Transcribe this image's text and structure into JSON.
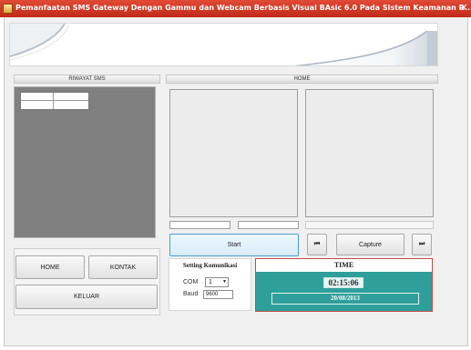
{
  "window": {
    "title": "Pemanfaatan SMS Gateway Dengan Gammu dan Webcam Berbasis Visual BAsic 6.0 Pada Sistem Keamanan R...",
    "close_glyph": "✕"
  },
  "riwayat": {
    "header": "RIWAYAT SMS"
  },
  "home_panel": {
    "header": "HOME",
    "start_label": "Start",
    "capture_label": "Capture",
    "prev_glyph": "⏮",
    "next_glyph": "⏭"
  },
  "nav": {
    "home_label": "HOME",
    "kontak_label": "KONTAK",
    "keluar_label": "KELUAR"
  },
  "setting": {
    "title": "Setting Komunikasi",
    "com_label": "COM",
    "com_value": "1",
    "baud_label": "Baud",
    "baud_value": "9600"
  },
  "time": {
    "title": "TIME",
    "clock": "02:15:06",
    "date": "20/08/2013"
  },
  "colors": {
    "titlebar": "#d03a26",
    "time_panel": "#2e9f9a",
    "time_border": "#c54a4a"
  }
}
